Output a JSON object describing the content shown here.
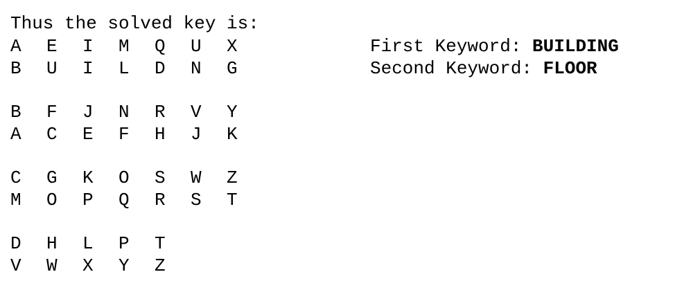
{
  "intro": "Thus the solved key is:",
  "groups": [
    {
      "top": [
        "A",
        "E",
        "I",
        "M",
        "Q",
        "U",
        "X"
      ],
      "bottom": [
        "B",
        "U",
        "I",
        "L",
        "D",
        "N",
        "G"
      ]
    },
    {
      "top": [
        "B",
        "F",
        "J",
        "N",
        "R",
        "V",
        "Y"
      ],
      "bottom": [
        "A",
        "C",
        "E",
        "F",
        "H",
        "J",
        "K"
      ]
    },
    {
      "top": [
        "C",
        "G",
        "K",
        "O",
        "S",
        "W",
        "Z"
      ],
      "bottom": [
        "M",
        "O",
        "P",
        "Q",
        "R",
        "S",
        "T"
      ]
    },
    {
      "top": [
        "D",
        "H",
        "L",
        "P",
        "T"
      ],
      "bottom": [
        "V",
        "W",
        "X",
        "Y",
        "Z"
      ]
    }
  ],
  "keywords": [
    {
      "label": "First Keyword: ",
      "value": "BUILDING"
    },
    {
      "label": "Second Keyword: ",
      "value": "FLOOR"
    }
  ]
}
